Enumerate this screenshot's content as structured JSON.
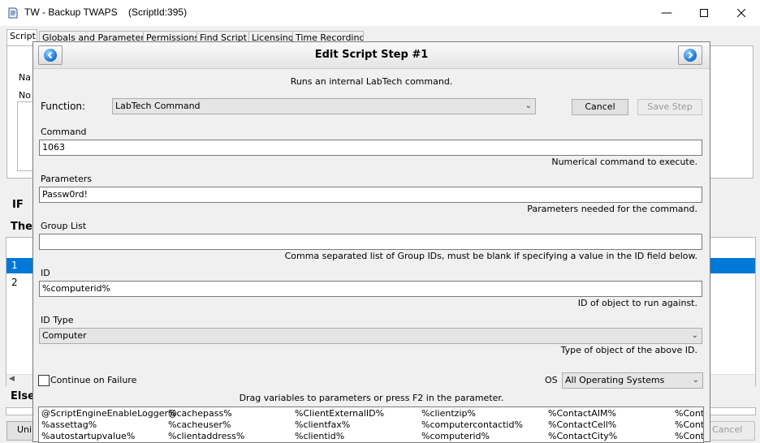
{
  "window": {
    "title": "TW - Backup TWAPS",
    "script_id": "(ScriptId:395)",
    "tabs": [
      "Script",
      "Globals and Parameters",
      "Permissions",
      "Find Script",
      "Licensing",
      "Time Recording"
    ],
    "bg_label_name": "Na",
    "bg_label_notes": "No",
    "if_label": "IF",
    "then_label": "The",
    "else_label": "Else",
    "rows": [
      "1",
      "2"
    ],
    "bottom_left_button": "Uni",
    "bottom_right_button": "Cancel"
  },
  "dialog": {
    "title": "Edit Script Step #1",
    "description": "Runs an internal LabTech command.",
    "function_label": "Function:",
    "function_value": "LabTech Command",
    "cancel_button": "Cancel",
    "save_button": "Save Step",
    "command_label": "Command",
    "command_value": "1063",
    "command_hint": "Numerical command to execute.",
    "parameters_label": "Parameters",
    "parameters_value": "Passw0rd!",
    "parameters_hint": "Parameters needed for the command.",
    "group_list_label": "Group List",
    "group_list_value": "",
    "group_list_hint": "Comma separated list of Group IDs, must be blank if specifying a value in the ID field below.",
    "id_label": "ID",
    "id_value": "%computerid%",
    "id_hint": "ID of object to run against.",
    "id_type_label": "ID Type",
    "id_type_value": "Computer",
    "id_type_hint": "Type of object of the above ID.",
    "continue_on_failure_label": "Continue on Failure",
    "continue_on_failure_checked": false,
    "os_label": "OS",
    "os_value": "All Operating Systems",
    "drag_hint": "Drag variables to parameters or press F2 in the parameter.",
    "variables": [
      [
        "@ScriptEngineEnableLogger@",
        "%cachepass%",
        "%ClientExternalID%",
        "%clientzip%",
        "%ContactAIM%",
        "%Cont"
      ],
      [
        "%assettag%",
        "%cacheuser%",
        "%clientfax%",
        "%computercontactid%",
        "%ContactCell%",
        "%Cont"
      ],
      [
        "%autostartupvalue%",
        "%clientaddress%",
        "%clientid%",
        "%computerid%",
        "%ContactCity%",
        "%Cont"
      ]
    ]
  },
  "colors": {
    "selection": "#0078d7",
    "nav_button": "#1a6fd0"
  }
}
